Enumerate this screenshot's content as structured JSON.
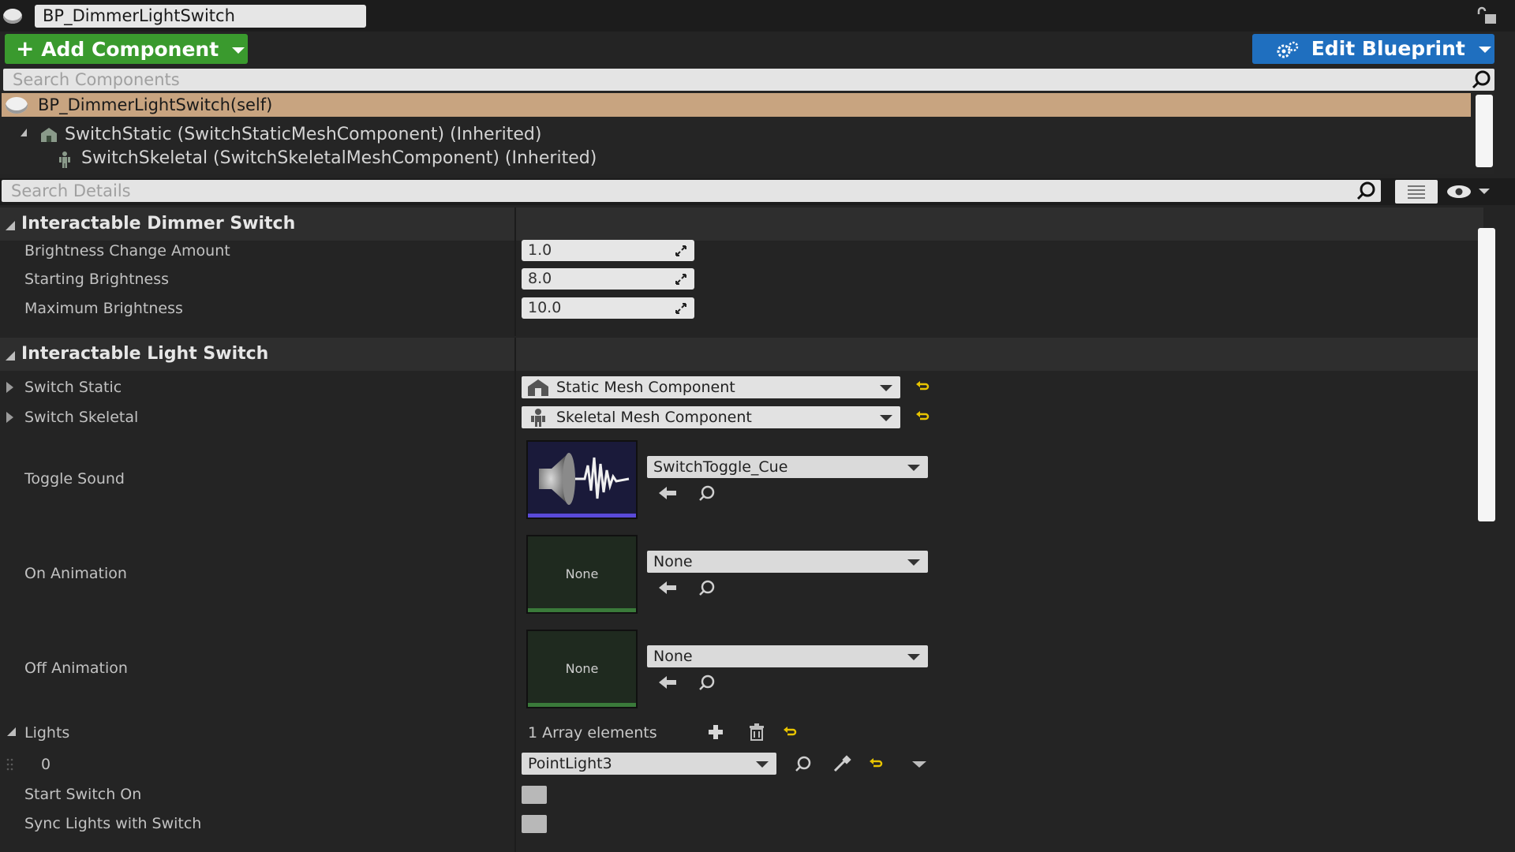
{
  "header": {
    "blueprint_name": "BP_DimmerLightSwitch",
    "add_component_label": "Add Component",
    "edit_blueprint_label": "Edit Blueprint",
    "search_components_placeholder": "Search Components"
  },
  "components": {
    "self_label": "BP_DimmerLightSwitch(self)",
    "items": [
      {
        "label": "SwitchStatic (SwitchStaticMeshComponent) (Inherited)",
        "icon": "static-mesh-icon"
      },
      {
        "label": "SwitchSkeletal (SwitchSkeletalMeshComponent) (Inherited)",
        "icon": "skeletal-mesh-icon"
      }
    ]
  },
  "details": {
    "search_placeholder": "Search Details",
    "categories": [
      {
        "title": "Interactable Dimmer Switch",
        "properties": [
          {
            "label": "Brightness Change Amount",
            "value": "1.0"
          },
          {
            "label": "Starting Brightness",
            "value": "8.0"
          },
          {
            "label": "Maximum Brightness",
            "value": "10.0"
          }
        ]
      },
      {
        "title": "Interactable Light Switch",
        "properties": [
          {
            "label": "Switch Static",
            "value": "Static Mesh Component"
          },
          {
            "label": "Switch Skeletal",
            "value": "Skeletal Mesh Component"
          },
          {
            "label": "Toggle Sound",
            "value": "SwitchToggle_Cue"
          },
          {
            "label": "On Animation",
            "value": "None",
            "thumb": "None"
          },
          {
            "label": "Off Animation",
            "value": "None",
            "thumb": "None"
          },
          {
            "label": "Lights",
            "value": "1 Array elements"
          },
          {
            "label": "0",
            "value": "PointLight3"
          },
          {
            "label": "Start Switch On"
          },
          {
            "label": "Sync Lights with Switch"
          }
        ]
      }
    ]
  },
  "colors": {
    "add_button": "#3a9a2e",
    "edit_button": "#1f6fbf",
    "selected_row": "#c8a480",
    "reset_arrow": "#e8c400"
  }
}
